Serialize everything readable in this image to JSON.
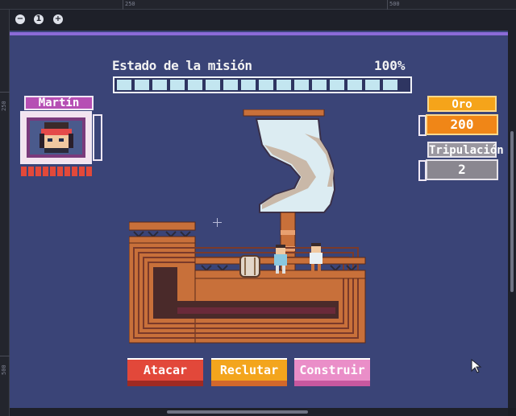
{
  "editor": {
    "ruler_top_labels": [
      "250",
      "500"
    ],
    "ruler_left_labels": [
      "250",
      "500"
    ],
    "zoom_out": "−",
    "zoom_reset": "1",
    "zoom_in": "+"
  },
  "hud": {
    "mission": {
      "label": "Estado de la misión",
      "percent": "100%",
      "progress_fraction": 1.0,
      "segments": 16
    },
    "player": {
      "name": "Martín",
      "health_fraction": 1.0
    },
    "gold": {
      "label": "Oro",
      "value": "200"
    },
    "crew": {
      "label": "Tripulación",
      "value": "2"
    }
  },
  "actions": {
    "attack": "Atacar",
    "recruit": "Reclutar",
    "build": "Construir"
  },
  "colors": {
    "background": "#3a4477",
    "accent_line": "#8b6bd8",
    "attack": "#e2483a",
    "recruit": "#f3a51d",
    "build": "#ea8ec8",
    "gold": "#f08617",
    "crew": "#8a8790",
    "name_tag": "#b64fb4",
    "wood": "#c8703a"
  },
  "icons": [
    "crosshair-icon",
    "mouse-cursor-icon",
    "zoom-out-icon",
    "zoom-reset-icon",
    "zoom-in-icon"
  ]
}
